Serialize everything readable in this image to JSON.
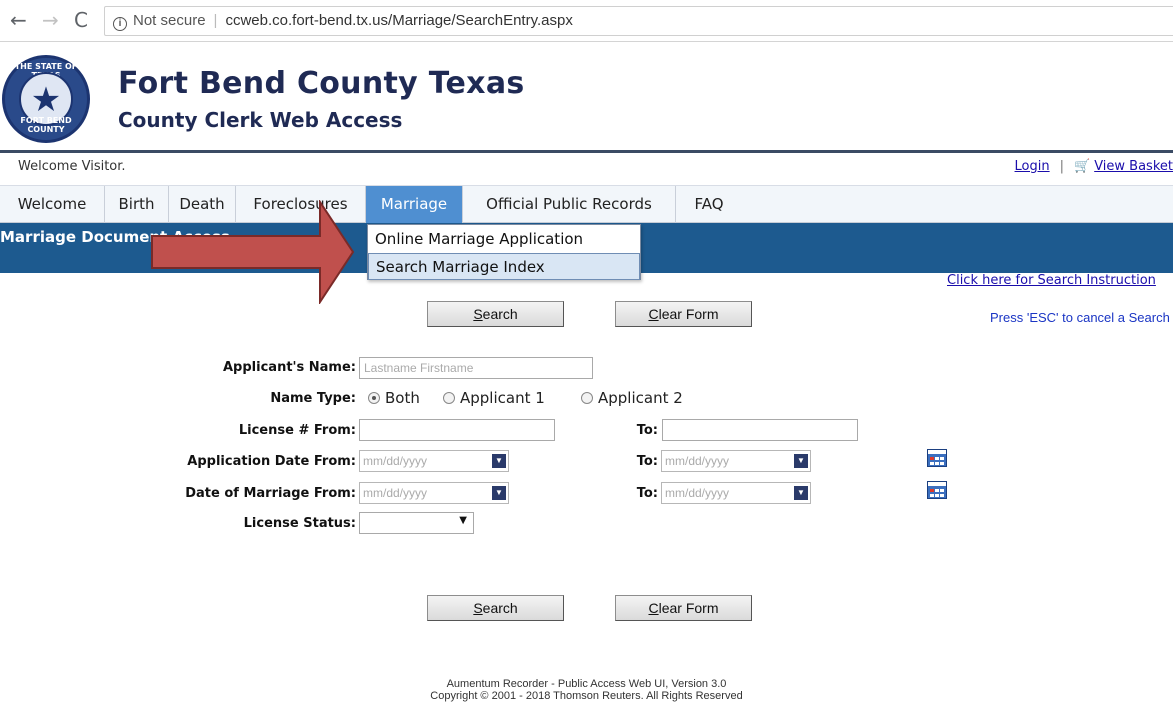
{
  "browser": {
    "security_label": "Not secure",
    "url": "ccweb.co.fort-bend.tx.us/Marriage/SearchEntry.aspx",
    "back_icon": "arrow-left-icon",
    "forward_icon": "arrow-right-icon",
    "reload_icon": "reload-icon"
  },
  "header": {
    "seal_top_text": "THE STATE OF TEXAS",
    "seal_bottom_text": "FORT BEND COUNTY",
    "title": "Fort Bend County Texas",
    "subtitle": "County Clerk Web Access"
  },
  "topbar": {
    "welcome": "Welcome Visitor.",
    "login": "Login",
    "separator": "|",
    "basket": "View Basket"
  },
  "menu": {
    "items": [
      {
        "label": "Welcome"
      },
      {
        "label": "Birth"
      },
      {
        "label": "Death"
      },
      {
        "label": "Foreclosures"
      },
      {
        "label": "Marriage"
      },
      {
        "label": "Official Public Records"
      },
      {
        "label": "FAQ"
      }
    ],
    "active": "Marriage",
    "dropdown": [
      {
        "label": "Online Marriage Application"
      },
      {
        "label": "Search Marriage Index"
      }
    ]
  },
  "band": {
    "title": "Marriage Document Access"
  },
  "side": {
    "instructions_link": "Click here for Search Instruction",
    "esc_note": "Press 'ESC' to cancel a Search"
  },
  "buttons": {
    "search_prefix": "S",
    "search_rest": "earch",
    "clear_prefix": "C",
    "clear_rest": "lear Form"
  },
  "form": {
    "applicant_name_label": "Applicant's Name:",
    "applicant_name_placeholder": "Lastname Firstname",
    "name_type_label": "Name Type:",
    "name_type_options": [
      "Both",
      "Applicant 1",
      "Applicant 2"
    ],
    "name_type_selected": "Both",
    "license_from_label": "License # From:",
    "license_to_label": "To:",
    "app_date_from_label": "Application Date From:",
    "app_date_to_label": "To:",
    "marriage_date_from_label": "Date of Marriage From:",
    "marriage_date_to_label": "To:",
    "date_placeholder": "mm/dd/yyyy",
    "license_status_label": "License Status:",
    "license_status_value": ""
  },
  "footer": {
    "line1": "Aumentum Recorder - Public Access Web UI, Version 3.0",
    "line2": "Copyright © 2001 - 2018  Thomson Reuters. All Rights Reserved"
  },
  "colors": {
    "menu_active": "#4f8fd1",
    "band": "#1d5a8f",
    "title_text": "#1f2a54",
    "arrow_fill": "#c0504d"
  }
}
